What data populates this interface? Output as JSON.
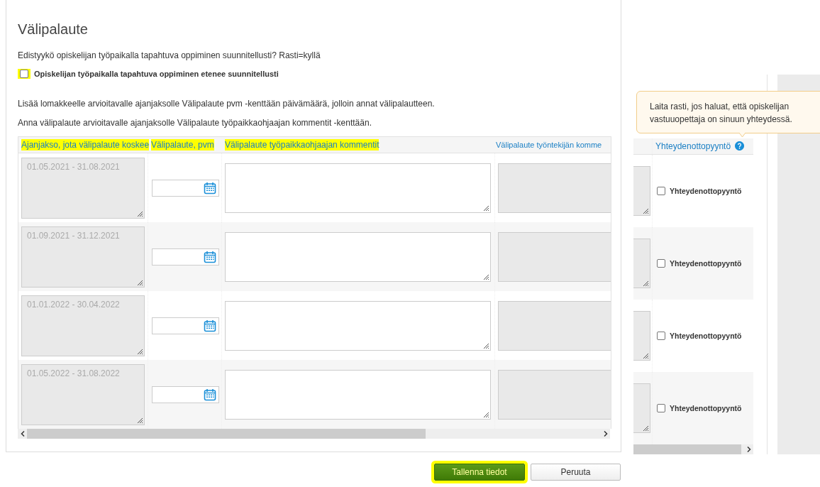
{
  "title": "Välipalaute",
  "question": "Edistyykö opiskelijan työpaikalla tapahtuva oppiminen suunnitellusti? Rasti=kyllä",
  "progress_checkbox": {
    "label": "Opiskelijan työpaikalla tapahtuva oppiminen etenee suunnitellusti",
    "checked": false,
    "highlighted": true
  },
  "instructions": [
    "Lisää lomakkeelle arvioitavalle ajanjaksolle Välipalaute pvm -kenttään päivämäärä, jolloin annat välipalautteen.",
    "Anna välipalaute arvioitavalle ajanjaksolle Välipalaute työpaikkaohjaajan kommentit -kenttään."
  ],
  "table": {
    "columns": [
      {
        "label": "Ajanjakso, jota välipalaute koskee",
        "highlighted": true
      },
      {
        "label": "Välipalaute, pvm",
        "highlighted": true
      },
      {
        "label": "Välipalaute työpaikkaohjaajan kommentit",
        "highlighted": true
      },
      {
        "label": "Välipalaute työntekijän komme",
        "highlighted": false
      }
    ],
    "rows": [
      {
        "period": "01.05.2021 - 31.08.2021"
      },
      {
        "period": "01.09.2021 - 31.12.2021"
      },
      {
        "period": "01.01.2022 - 30.04.2022"
      },
      {
        "period": "01.05.2022 - 31.08.2022"
      }
    ]
  },
  "side_table": {
    "column": "Yhteydenottopyyntö",
    "rows": [
      {
        "label": "Yhteydenottopyyntö",
        "checked": false
      },
      {
        "label": "Yhteydenottopyyntö",
        "checked": false
      },
      {
        "label": "Yhteydenottopyyntö",
        "checked": false
      },
      {
        "label": "Yhteydenottopyyntö",
        "checked": false
      }
    ]
  },
  "tooltip": "Laita rasti, jos haluat, että opiskelijan vastuuopettaja on sinuun yhteydessä.",
  "buttons": [
    {
      "label": "Tallenna tiedot",
      "kind": "primary",
      "highlighted": true
    },
    {
      "label": "Peruuta",
      "kind": "secondary"
    }
  ]
}
